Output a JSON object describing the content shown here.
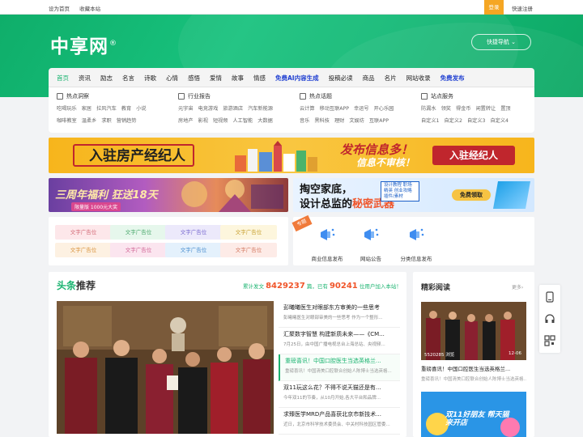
{
  "topbar": {
    "set_home": "设为首页",
    "bookmark": "收藏本站",
    "register": "登录",
    "quick_register": "快速注册"
  },
  "header": {
    "logo_text": "中享网",
    "logo_mark": "®",
    "quick_nav": "快捷导航"
  },
  "nav": {
    "items": [
      {
        "label": "首页"
      },
      {
        "label": "资讯"
      },
      {
        "label": "励志"
      },
      {
        "label": "名言"
      },
      {
        "label": "诗歌"
      },
      {
        "label": "心情"
      },
      {
        "label": "感悟"
      },
      {
        "label": "爱情"
      },
      {
        "label": "故事"
      },
      {
        "label": "情感"
      },
      {
        "label": "免费AI内容生成"
      },
      {
        "label": "投稿必读"
      },
      {
        "label": "商品"
      },
      {
        "label": "名片"
      },
      {
        "label": "网站收录"
      },
      {
        "label": "免费发布"
      }
    ]
  },
  "subnav": {
    "cols": [
      {
        "title": "热点洞察",
        "row1": [
          "吃喝玩乐",
          "家居",
          "拉风汽车",
          "教育",
          "小说"
        ],
        "row2": [
          "咖啡教室",
          "温柔乡",
          "求职",
          "营销趋势"
        ]
      },
      {
        "title": "行业报告",
        "row1": [
          "元宇宙",
          "电竞游戏",
          "旅游酒店",
          "汽车新能源"
        ],
        "row2": [
          "房地产",
          "影视",
          "短视频",
          "人工智能",
          "大数据"
        ]
      },
      {
        "title": "热点话题",
        "row1": [
          "云计算",
          "移动互联APP",
          "幸运号",
          "开心乐园"
        ],
        "row2": [
          "音乐",
          "黑科技",
          "理财",
          "文娱坊",
          "互联APP"
        ]
      },
      {
        "title": "站点服务",
        "row1": [
          "防漏水",
          "领奖",
          "得金币",
          "闲置转让",
          "置顶"
        ],
        "row2": [
          "自定义1",
          "自定义2",
          "自定义3",
          "自定义4"
        ]
      }
    ]
  },
  "banner1": {
    "left_text": "入驻房产经纪人",
    "mid_line1": "发布信息多！",
    "mid_line2": "信息不审核！",
    "button": "入驻经纪人"
  },
  "banner2a": {
    "title": "三周年福利 狂送18天",
    "sub": "限量版 1000元大奖"
  },
  "banner2b": {
    "line1": "掏空家底，",
    "line2a": "设计总监的",
    "line2b": "秘密武器",
    "tags": "设计教程 职场精英 创业攻略 插件/素材",
    "button": "免费领取"
  },
  "ads": {
    "cells": [
      "文字广告位",
      "文字广告位",
      "文字广告位",
      "文字广告位",
      "文字广告位",
      "文字广告位",
      "文字广告位",
      "文字广告位"
    ]
  },
  "services": {
    "flag": "专题",
    "items": [
      {
        "label": "商业信息发布"
      },
      {
        "label": "网站公告"
      },
      {
        "label": "分类信息发布"
      }
    ]
  },
  "headline": {
    "title_a": "头条",
    "title_b": "推荐",
    "stat_prefix": "累计发文",
    "posts": "8429237",
    "stat_mid": "篇，已有",
    "users": "90241",
    "stat_suffix": "位用户加入本站！",
    "list": [
      {
        "title": "彭曦曦医生对眼部东方审美的一些思考",
        "desc": "彭曦曦医生对眼部审美的一些思考 作为一个整形..."
      },
      {
        "title": "汇聚数字智慧 构建新质未来——《CM...",
        "desc": "7月25日，由中国广播电视总台上海总站、央视频..."
      },
      {
        "title": "重磅喜讯！中国口腔医生当选英格兰...",
        "desc": "重磅喜讯！中国清美口腔联合创始人陈博士当选英格..."
      },
      {
        "title": "双11玩这么花？不得不说天猫还是有...",
        "desc": "今年双11的节奏，从10月开始,各大平台和品牌..."
      },
      {
        "title": "求臻医学MRD产品喜获北京市新技术...",
        "desc": "近日，北京市科学技术委员会、中关村科技园区管委..."
      }
    ]
  },
  "side": {
    "title": "精彩阅读",
    "more": "更多›",
    "img_views": "5520285 浏览",
    "img_date": "12-06",
    "caption": "重磅喜讯！中国口腔医生当选英格兰...",
    "desc": "重磅喜讯！中国清美口腔联合创始人陈博士当选英格...",
    "img2_text": "双11好朋友 帮天猫来开店"
  },
  "colors": {
    "brand": "#19b36f",
    "accent": "#f5a623",
    "ai_link": "#1f3fd1",
    "stat_number": "#f0552a"
  }
}
